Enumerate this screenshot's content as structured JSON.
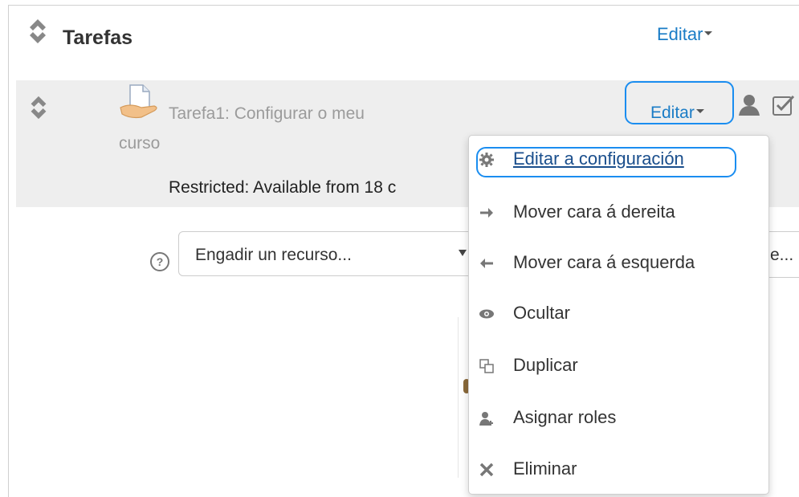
{
  "section": {
    "title": "Tarefas",
    "edit_label": "Editar"
  },
  "activity": {
    "name_line1": "Tarefa1: Configurar o meu",
    "name_line2": "curso",
    "restricted": "Restricted: Available from 18 c",
    "edit_label": "Editar"
  },
  "add_resource": {
    "placeholder": "Engadir un recurso...",
    "second_partial": "e..."
  },
  "menu": {
    "items": [
      {
        "label": "Editar a configuración",
        "icon": "gear-icon"
      },
      {
        "label": "Mover cara á dereita",
        "icon": "arrow-right-icon"
      },
      {
        "label": "Mover cara á esquerda",
        "icon": "arrow-left-icon"
      },
      {
        "label": "Ocultar",
        "icon": "eye-icon"
      },
      {
        "label": "Duplicar",
        "icon": "duplicate-icon"
      },
      {
        "label": "Asignar roles",
        "icon": "user-add-icon"
      },
      {
        "label": "Eliminar",
        "icon": "close-icon"
      }
    ]
  },
  "colors": {
    "link": "#1a7cc6",
    "focus": "#1a8df0",
    "activity_bg": "#eeeeee"
  }
}
